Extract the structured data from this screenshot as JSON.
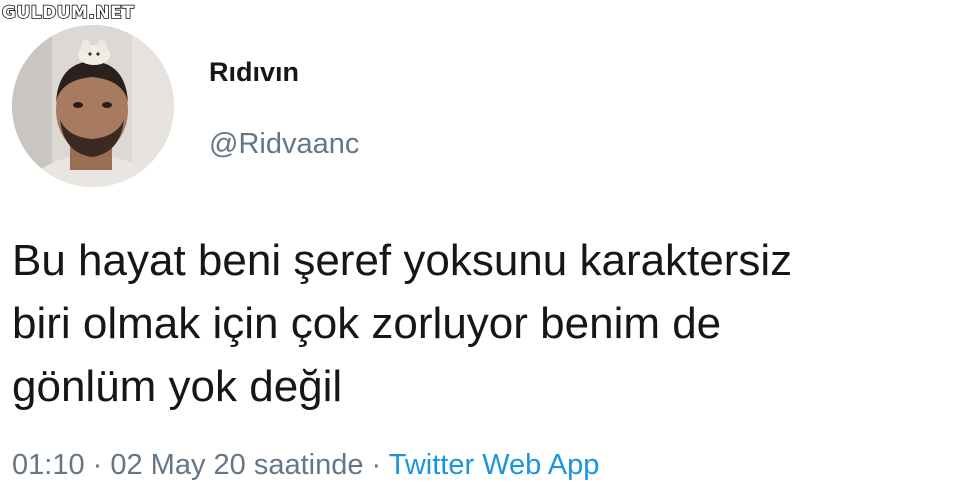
{
  "watermark": "GULDUM.NET",
  "user": {
    "display_name": "Rıdıvın",
    "handle": "@Ridvaanc"
  },
  "tweet": {
    "text": "Bu hayat beni şeref yoksunu karaktersiz\nbiri olmak için çok zorluyor benim de\ngönlüm yok değil",
    "time": "01:10",
    "separator": " · ",
    "date": "02 May 20 saatinde",
    "source": "Twitter Web App"
  },
  "colors": {
    "text_primary": "#14171a",
    "text_secondary": "#657786",
    "link": "#1b95e0",
    "background": "#ffffff"
  }
}
